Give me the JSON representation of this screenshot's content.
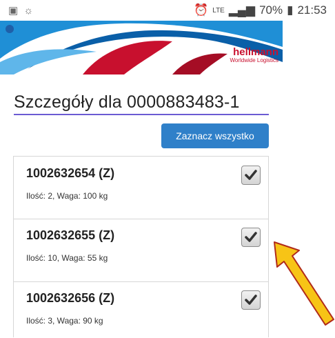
{
  "status_bar": {
    "left_icons": [
      "gallery-icon",
      "brightness-icon"
    ],
    "right_icons": [
      "alarm-icon",
      "lte-icon",
      "signal-icon",
      "battery-icon"
    ],
    "network": "LTE",
    "battery": "70%",
    "time": "21:53"
  },
  "banner": {
    "brand_name": "hellmann",
    "brand_tagline": "Worldwide Logistics",
    "colors": {
      "blue": "#1f8fd6",
      "red": "#c8102e"
    }
  },
  "page": {
    "title": "Szczegóły dla 0000883483-1",
    "select_all_label": "Zaznacz wszystko",
    "accent_color": "#2f80c9"
  },
  "items": [
    {
      "title": "1002632654 (Z)",
      "info": "Ilość: 2, Waga: 100 kg",
      "checked": true
    },
    {
      "title": "1002632655 (Z)",
      "info": "Ilość: 10, Waga: 55 kg",
      "checked": true
    },
    {
      "title": "1002632656 (Z)",
      "info": "Ilość: 3, Waga: 90 kg",
      "checked": true
    }
  ]
}
